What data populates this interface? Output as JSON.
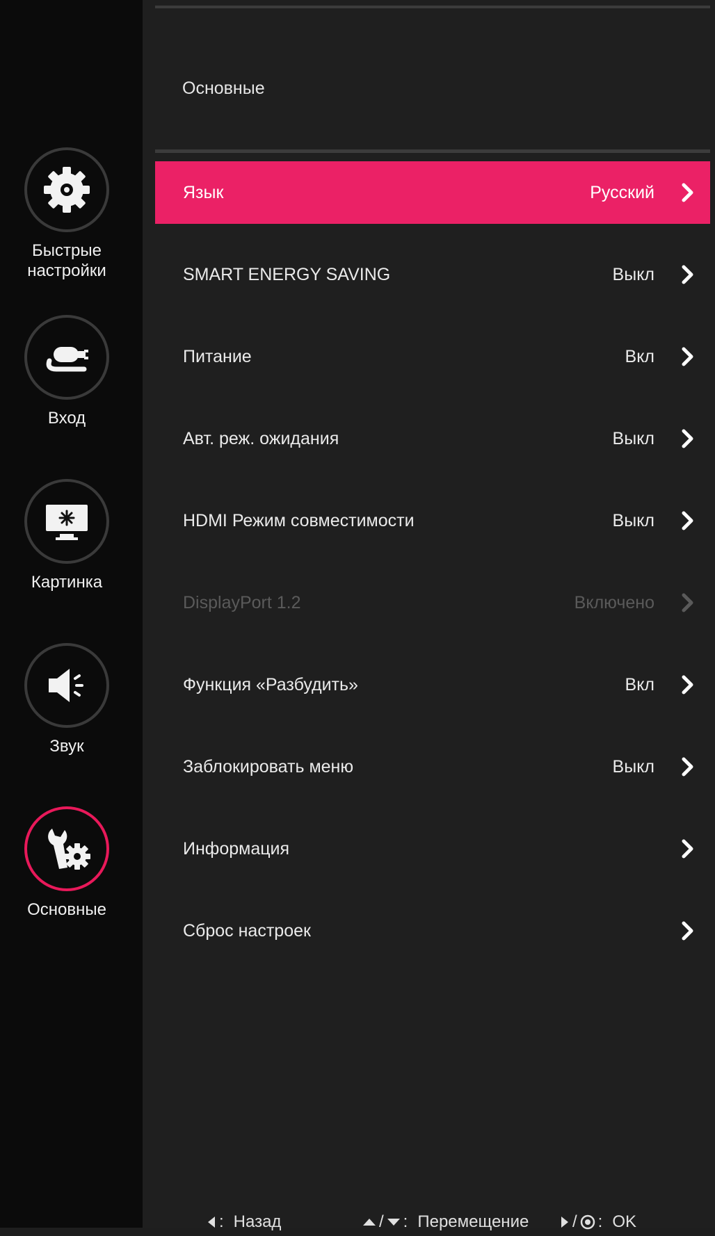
{
  "colors": {
    "accent": "#eb2166",
    "background": "#1f1f1f",
    "sidebar": "#0b0b0b"
  },
  "sidebar": {
    "items": [
      {
        "label": "Быстрые\nнастройки",
        "icon": "gear-icon",
        "active": false
      },
      {
        "label": "Вход",
        "icon": "input-plug-icon",
        "active": false
      },
      {
        "label": "Картинка",
        "icon": "monitor-icon",
        "active": false
      },
      {
        "label": "Звук",
        "icon": "speaker-icon",
        "active": false
      },
      {
        "label": "Основные",
        "icon": "wrench-gear-icon",
        "active": true
      }
    ]
  },
  "main": {
    "section_title": "Основные",
    "rows": [
      {
        "label": "Язык",
        "value": "Русский",
        "selected": true,
        "disabled": false
      },
      {
        "label": "SMART ENERGY SAVING",
        "value": "Выкл",
        "selected": false,
        "disabled": false
      },
      {
        "label": "Питание",
        "value": "Вкл",
        "selected": false,
        "disabled": false
      },
      {
        "label": "Авт. реж. ожидания",
        "value": "Выкл",
        "selected": false,
        "disabled": false
      },
      {
        "label": "HDMI Режим совместимости",
        "value": "Выкл",
        "selected": false,
        "disabled": false
      },
      {
        "label": "DisplayPort 1.2",
        "value": "Включено",
        "selected": false,
        "disabled": true
      },
      {
        "label": "Функция «Разбудить»",
        "value": "Вкл",
        "selected": false,
        "disabled": false
      },
      {
        "label": "Заблокировать меню",
        "value": "Выкл",
        "selected": false,
        "disabled": false
      },
      {
        "label": "Информация",
        "value": "",
        "selected": false,
        "disabled": false
      },
      {
        "label": "Сброс настроек",
        "value": "",
        "selected": false,
        "disabled": false
      }
    ]
  },
  "footer": {
    "back_label": "Назад",
    "move_label": "Перемещение",
    "ok_label": "OK",
    "sep": "/",
    "colon": ":"
  }
}
